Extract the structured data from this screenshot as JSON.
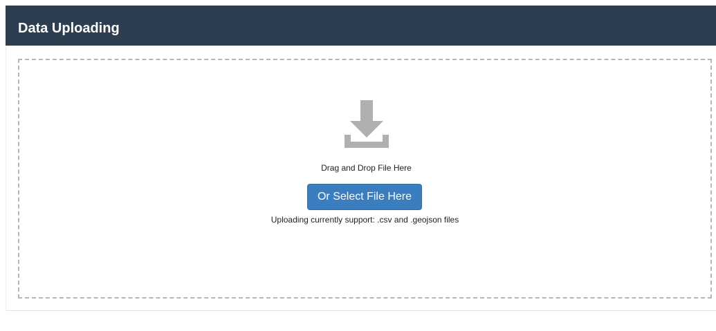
{
  "header": {
    "title": "Data Uploading"
  },
  "dropzone": {
    "icon": "download-icon",
    "drag_text": "Drag and Drop File Here",
    "select_label": "Or Select File Here",
    "support_text": "Uploading currently support: .csv and .geojson files"
  },
  "colors": {
    "header_bg": "#2d3e50",
    "button_bg": "#3a7ec0",
    "icon": "#b0b0b0",
    "dropzone_border": "#b5b5b5"
  }
}
